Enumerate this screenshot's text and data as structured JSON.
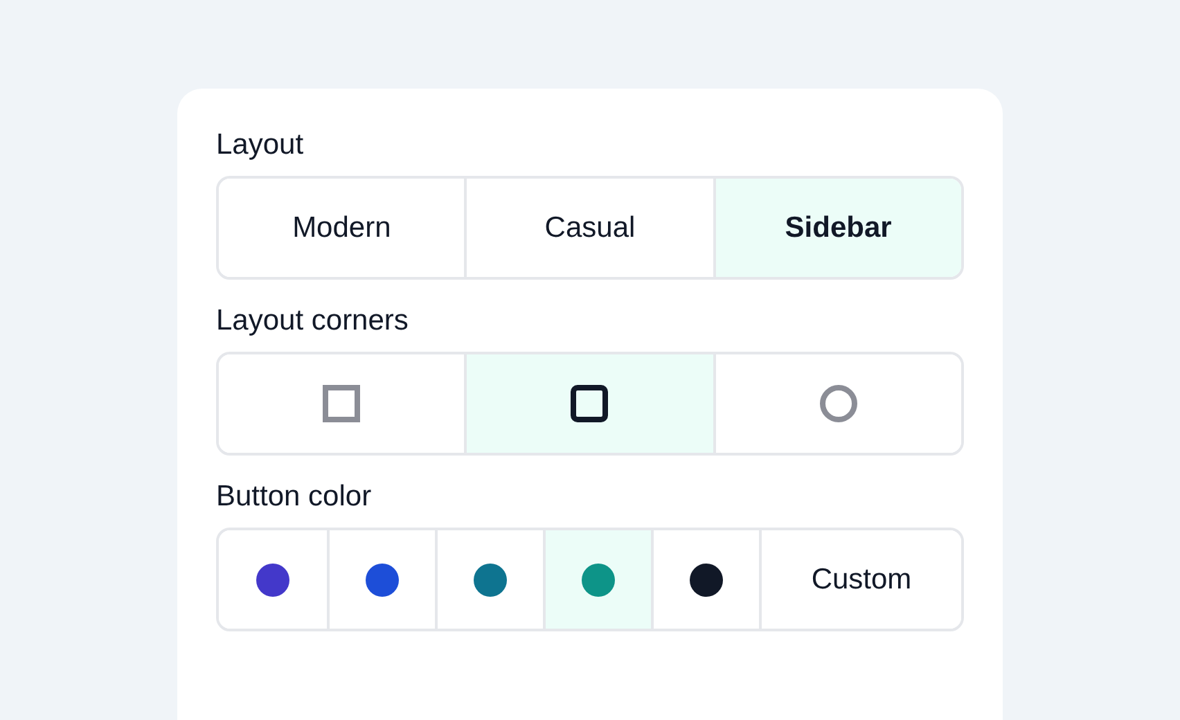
{
  "sections": [
    {
      "kind": "text",
      "label": "Layout",
      "options": [
        {
          "label": "Modern",
          "selected": false
        },
        {
          "label": "Casual",
          "selected": false
        },
        {
          "label": "Sidebar",
          "selected": true
        }
      ]
    },
    {
      "kind": "corners",
      "label": "Layout corners",
      "options": [
        {
          "kind": "square",
          "selected": false
        },
        {
          "kind": "rounded",
          "selected": true
        },
        {
          "kind": "round",
          "selected": false
        }
      ]
    },
    {
      "kind": "colors",
      "label": "Button color",
      "options": [
        {
          "kind": "swatch",
          "color": "#4338ca",
          "selected": false
        },
        {
          "kind": "swatch",
          "color": "#1d4ed8",
          "selected": false
        },
        {
          "kind": "swatch",
          "color": "#0e7490",
          "selected": false
        },
        {
          "kind": "swatch",
          "color": "#0d9488",
          "selected": true
        },
        {
          "kind": "swatch",
          "color": "#111827",
          "selected": false
        },
        {
          "kind": "custom",
          "label": "Custom",
          "selected": false
        }
      ]
    }
  ]
}
